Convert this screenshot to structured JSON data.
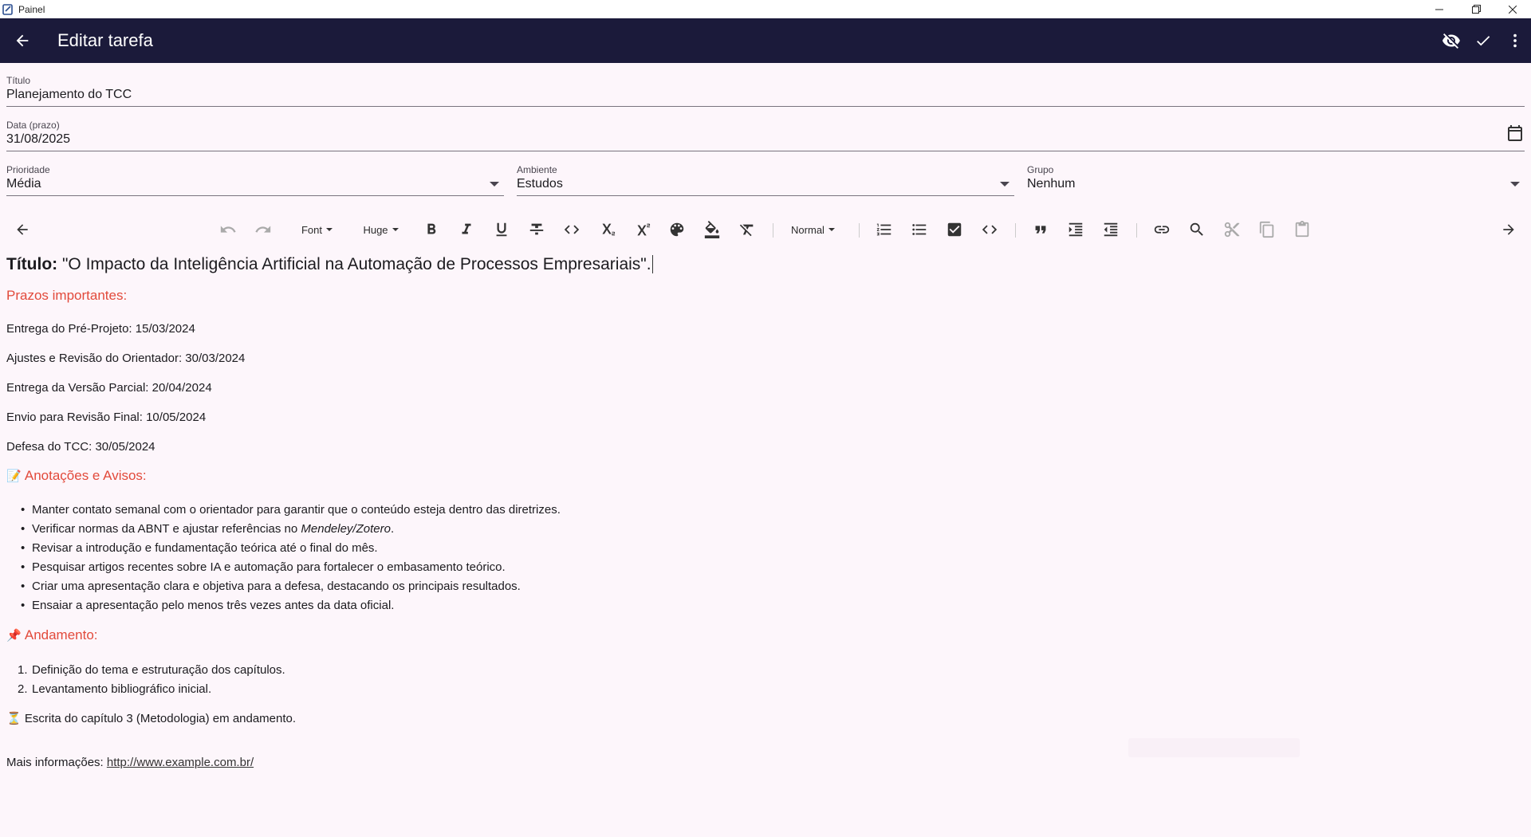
{
  "window": {
    "title": "Painel"
  },
  "appbar": {
    "title": "Editar tarefa"
  },
  "form": {
    "titulo": {
      "label": "Título",
      "value": "Planejamento do TCC"
    },
    "data": {
      "label": "Data (prazo)",
      "value": "31/08/2025"
    },
    "prioridade": {
      "label": "Prioridade",
      "value": "Média"
    },
    "ambiente": {
      "label": "Ambiente",
      "value": "Estudos"
    },
    "grupo": {
      "label": "Grupo",
      "value": "Nenhum"
    }
  },
  "toolbar": {
    "font": "Font",
    "size": "Huge",
    "header": "Normal"
  },
  "content": {
    "heading_bold": "Título:",
    "heading_rest": " \"O Impacto da Inteligência Artificial na Automação de Processos Empresariais\".",
    "deadlines_title": "Prazos importantes:",
    "deadlines": [
      "Entrega do Pré-Projeto: 15/03/2024",
      "Ajustes e Revisão do Orientador: 30/03/2024",
      "Entrega da Versão Parcial: 20/04/2024",
      "Envio para Revisão Final: 10/05/2024",
      "Defesa do TCC: 30/05/2024"
    ],
    "notes_emoji": "📝",
    "notes_title": "Anotações e Avisos:",
    "notes": [
      "Manter contato semanal com o orientador para garantir que o conteúdo esteja dentro das diretrizes.",
      "Verificar normas da ABNT e ajustar referências no ",
      "Revisar a introdução e fundamentação teórica até o final do mês.",
      "Pesquisar artigos recentes sobre IA e automação para fortalecer o embasamento teórico.",
      "Criar uma apresentação clara e objetiva para a defesa, destacando os principais resultados.",
      "Ensaiar a apresentação pelo menos três vezes antes da data oficial."
    ],
    "notes_italic": "Mendeley/Zotero",
    "notes_italic_after": ".",
    "progress_emoji": "📌",
    "progress_title": "Andamento:",
    "progress": [
      "Definição do tema e estruturação dos capítulos.",
      "Levantamento bibliográfico inicial."
    ],
    "progress_nums": [
      "1.",
      "2."
    ],
    "writing_emoji": "⏳",
    "writing": " Escrita do capítulo 3 (Metodologia) em andamento.",
    "more_label": "Mais informações: ",
    "more_link": "http://www.example.com.br/"
  }
}
